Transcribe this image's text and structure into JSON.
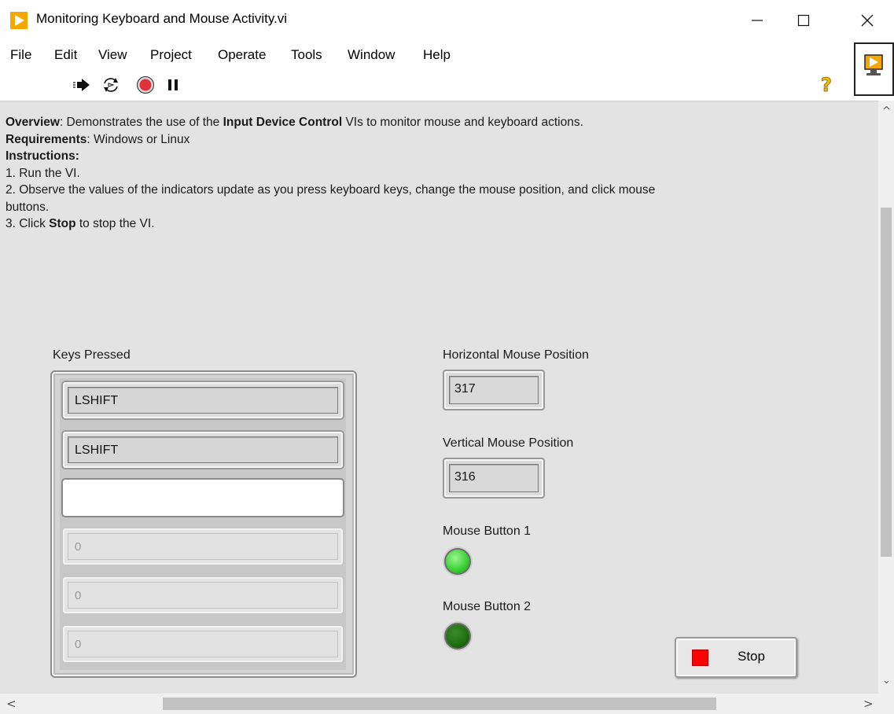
{
  "window": {
    "title": "Monitoring Keyboard and Mouse Activity.vi",
    "minimize_glyph": "—",
    "maximize_glyph": "☐",
    "close_glyph": "✕"
  },
  "menu": {
    "items": [
      {
        "label": "File"
      },
      {
        "label": "Edit"
      },
      {
        "label": "View"
      },
      {
        "label": "Project"
      },
      {
        "label": "Operate"
      },
      {
        "label": "Tools"
      },
      {
        "label": "Window"
      },
      {
        "label": "Help"
      }
    ]
  },
  "toolbar": {
    "icons": [
      "run-arrow-icon",
      "run-continuously-icon",
      "abort-icon",
      "pause-icon",
      "help-icon",
      "vi-icon"
    ]
  },
  "description": {
    "overview_label": "Overview",
    "overview_text_1": ": Demonstrates the use of the ",
    "overview_bold": "Input Device Control",
    "overview_text_2": " VIs to monitor mouse and keyboard actions.",
    "requirements_label": "Requirements",
    "requirements_text": ": Windows or Linux",
    "instructions_label": "Instructions:",
    "step1": "1. Run the VI.",
    "step2": "2. Observe the values of the indicators update as you press keyboard keys, change the mouse position, and click mouse",
    "step2_cont": "buttons.",
    "step3_a": "3. Click ",
    "step3_bold": "Stop",
    "step3_b": " to stop the VI."
  },
  "keys_pressed": {
    "label": "Keys Pressed",
    "elements": [
      "LSHIFT",
      "LSHIFT",
      "",
      "0",
      "0",
      "0"
    ]
  },
  "horizontal_mouse": {
    "label": "Horizontal Mouse Position",
    "value": "317"
  },
  "vertical_mouse": {
    "label": "Vertical Mouse Position",
    "value": "316"
  },
  "mouse_button_1": {
    "label": "Mouse Button 1",
    "state": "on",
    "color": "#3fd23a"
  },
  "mouse_button_2": {
    "label": "Mouse Button 2",
    "state": "off",
    "color": "#1f6e12"
  },
  "stop_button": {
    "label": "Stop",
    "color": "#ff0000"
  },
  "scroll": {
    "up": "^",
    "down": "⌄",
    "left": "<",
    "right": ">"
  }
}
